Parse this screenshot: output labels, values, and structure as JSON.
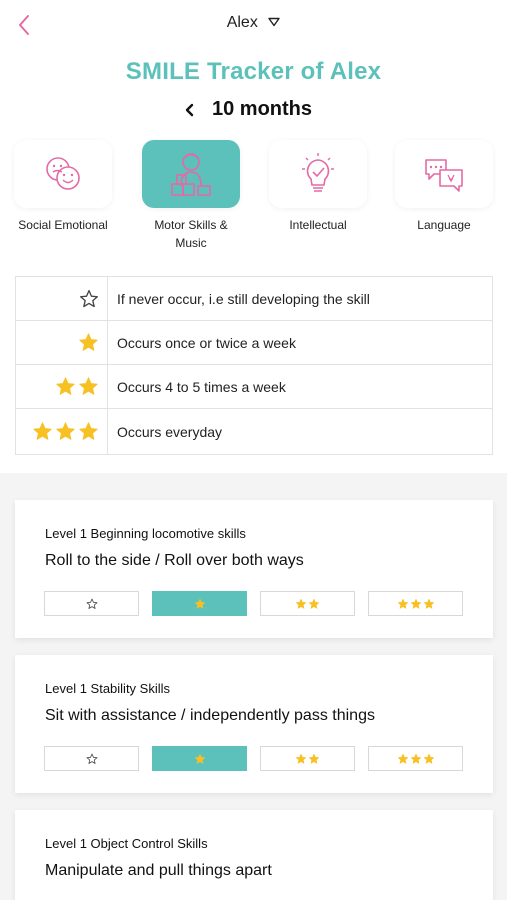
{
  "header": {
    "child_name": "Alex"
  },
  "title": "SMILE Tracker of Alex",
  "age": {
    "label": "10 months"
  },
  "categories": [
    {
      "label_line1": "Social Emotional",
      "label_line2": "",
      "icon": "smiley-faces-icon",
      "active": false
    },
    {
      "label_line1": "Motor Skills &",
      "label_line2": "Music",
      "icon": "child-playing-blocks-icon",
      "active": true
    },
    {
      "label_line1": "Intellectual",
      "label_line2": "",
      "icon": "lightbulb-check-icon",
      "active": false
    },
    {
      "label_line1": "Language",
      "label_line2": "",
      "icon": "speech-bubbles-icon",
      "active": false
    }
  ],
  "legend": [
    {
      "stars": 0,
      "text": "If never occur, i.e still developing the skill"
    },
    {
      "stars": 1,
      "text": "Occurs once or twice a week"
    },
    {
      "stars": 2,
      "text": "Occurs 4 to 5 times a week"
    },
    {
      "stars": 3,
      "text": "Occurs everyday"
    }
  ],
  "skills": [
    {
      "level": "Level 1 Beginning locomotive skills",
      "skill": "Roll to the side / Roll over both ways",
      "rating": 1
    },
    {
      "level": "Level 1 Stability Skills",
      "skill": "Sit with assistance / independently pass things",
      "rating": 1
    },
    {
      "level": "Level 1 Object Control Skills",
      "skill": "Manipulate and pull things apart",
      "rating": null
    }
  ],
  "colors": {
    "accent": "#5cc1bb",
    "pink": "#e46aa5",
    "star": "#f7c023"
  }
}
